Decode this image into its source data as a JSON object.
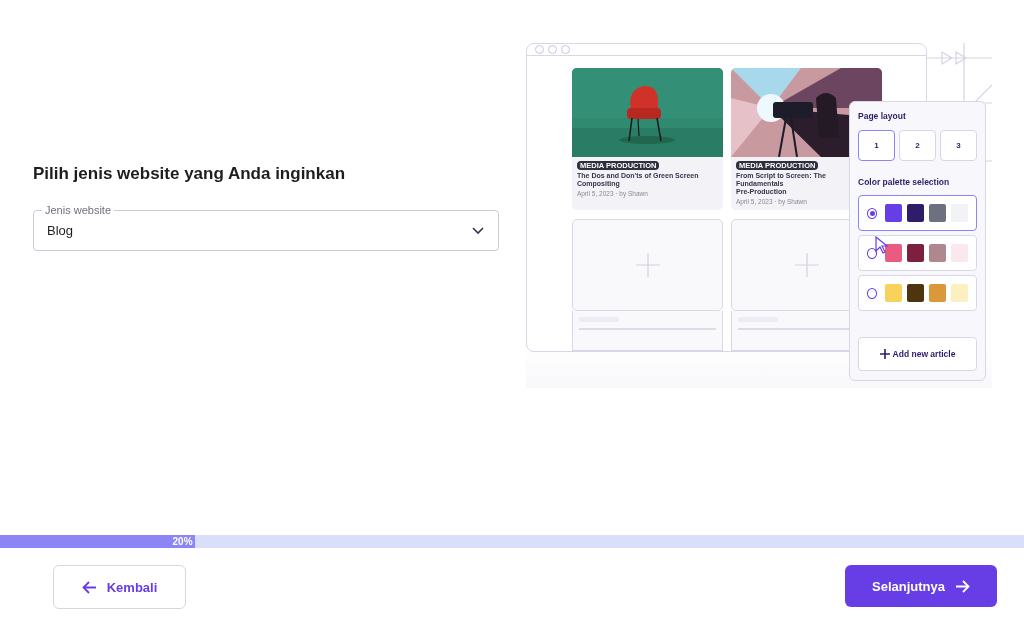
{
  "heading": "Pilih jenis website yang Anda inginkan",
  "website_type": {
    "label": "Jenis website",
    "value": "Blog"
  },
  "preview": {
    "articles": [
      {
        "kind": "picture",
        "tag": "MEDIA PRODUCTION",
        "title_lines": [
          "The Dos and Don'ts of Green Screen Compositing"
        ],
        "meta": "April 5, 2023 · by Shawn"
      },
      {
        "kind": "picture",
        "tag": "MEDIA PRODUCTION",
        "title_lines": [
          "From Script to Screen: The Fundamentals",
          "Pre-Production"
        ],
        "meta": "April 5, 2023 · by Shawn"
      }
    ],
    "panel": {
      "layout_title": "Page layout",
      "layouts": [
        {
          "label": "1",
          "selected": true
        },
        {
          "label": "2",
          "selected": false
        },
        {
          "label": "3",
          "selected": false
        }
      ],
      "palette_title": "Color palette selection",
      "palettes": [
        {
          "selected": true,
          "swatches": [
            {
              "color": "#673de6"
            },
            {
              "color": "#2f1c6a"
            },
            {
              "color": "#6d7081"
            },
            {
              "color": "#f2f3f6"
            }
          ]
        },
        {
          "selected": false,
          "swatches": [
            {
              "color": "#e95b81"
            },
            {
              "color": "#7d2040"
            },
            {
              "color": "#b0868f"
            },
            {
              "color": "#fbe8ee"
            }
          ]
        },
        {
          "selected": false,
          "swatches": [
            {
              "color": "#f7d35c"
            },
            {
              "color": "#4f3410"
            },
            {
              "color": "#dc9838"
            },
            {
              "color": "#fdf0c0"
            }
          ]
        }
      ],
      "add_button": "Add new article"
    }
  },
  "progress": {
    "level": 0.19,
    "label": "20%"
  },
  "buttons": {
    "back": "Kembali",
    "next": "Selanjutnya"
  }
}
